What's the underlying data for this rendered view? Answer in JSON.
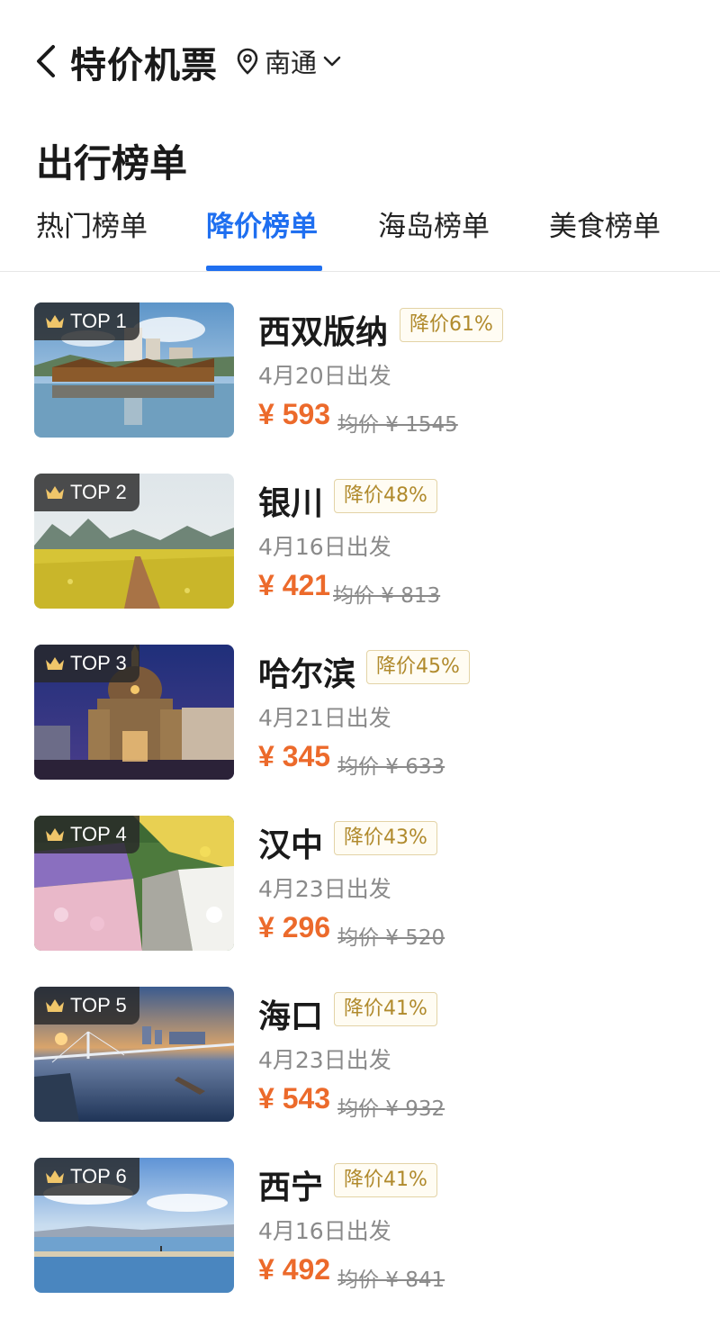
{
  "header": {
    "title": "特价机票",
    "location": "南通",
    "back_icon": "chevron-left-icon",
    "location_icon": "location-pin-icon",
    "dropdown_icon": "chevron-down-icon"
  },
  "section_title": "出行榜单",
  "tabs": [
    {
      "label": "热门榜单",
      "active": false
    },
    {
      "label": "降价榜单",
      "active": true
    },
    {
      "label": "海岛榜单",
      "active": false
    },
    {
      "label": "美食榜单",
      "active": false
    }
  ],
  "accent_color": "#1f6ff0",
  "price_color": "#ec6a2b",
  "items": [
    {
      "rank": "TOP 1",
      "city": "西双版纳",
      "discount": "降价61%",
      "date": "4月20日出发",
      "price": "¥ 593",
      "avg": "均价 ¥ 1545",
      "scene": "lake-town"
    },
    {
      "rank": "TOP 2",
      "city": "银川",
      "discount": "降价48%",
      "date": "4月16日出发",
      "price": "¥ 421",
      "avg": "均价 ¥ 813",
      "scene": "yellow-field"
    },
    {
      "rank": "TOP 3",
      "city": "哈尔滨",
      "discount": "降价45%",
      "date": "4月21日出发",
      "price": "¥ 345",
      "avg": "均价 ¥ 633",
      "scene": "cathedral-night"
    },
    {
      "rank": "TOP 4",
      "city": "汉中",
      "discount": "降价43%",
      "date": "4月23日出发",
      "price": "¥ 296",
      "avg": "均价 ¥ 520",
      "scene": "flower-garden"
    },
    {
      "rank": "TOP 5",
      "city": "海口",
      "discount": "降价41%",
      "date": "4月23日出发",
      "price": "¥ 543",
      "avg": "均价 ¥ 932",
      "scene": "bridge-sunset"
    },
    {
      "rank": "TOP 6",
      "city": "西宁",
      "discount": "降价41%",
      "date": "4月16日出发",
      "price": "¥ 492",
      "avg": "均价 ¥ 841",
      "scene": "lake-sky"
    }
  ]
}
